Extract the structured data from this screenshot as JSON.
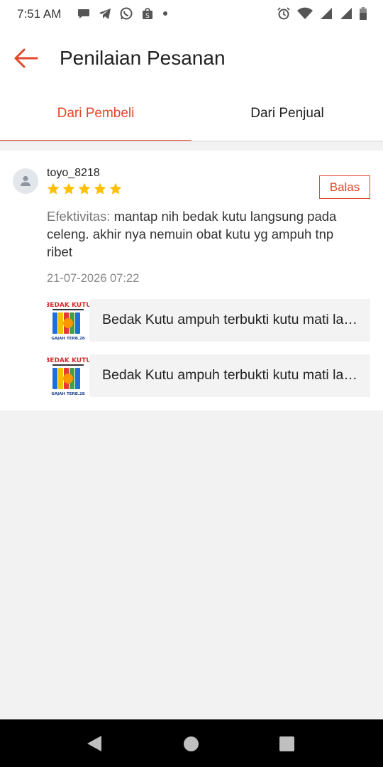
{
  "status_bar": {
    "time": "7:51 AM",
    "left_icons": [
      "chat-bubble-icon",
      "telegram-icon",
      "whatsapp-icon",
      "shopee-icon",
      "more-dot-icon"
    ],
    "right_icons": [
      "alarm-icon",
      "wifi-icon",
      "signal-icon",
      "signal-icon",
      "battery-icon"
    ]
  },
  "app_bar": {
    "title": "Penilaian Pesanan",
    "back_icon": "back-arrow-icon"
  },
  "tabs": [
    {
      "label": "Dari Pembeli",
      "active": true
    },
    {
      "label": "Dari Penjual",
      "active": false
    }
  ],
  "review": {
    "username": "toyo_8218",
    "rating": 5,
    "reply_label": "Balas",
    "text_label": "Efektivitas:",
    "text_body": " mantap nih bedak kutu langsung pada celeng. akhir nya nemuin obat kutu yg ampuh tnp ribet",
    "date": "21-07-2026 07:22",
    "products": [
      {
        "name": "Bedak Kutu ampuh terbukti kutu mati langsung",
        "thumb_text": [
          "BEDAK KUTU",
          "GAJAH TERB.28"
        ]
      },
      {
        "name": "Bedak Kutu ampuh terbukti kutu mati langsung",
        "thumb_text": [
          "BEDAK KUTU",
          "GAJAH TERB.28"
        ]
      }
    ]
  },
  "colors": {
    "accent": "#e1472b",
    "star": "#ffc107",
    "background": "#f2f2f2"
  }
}
